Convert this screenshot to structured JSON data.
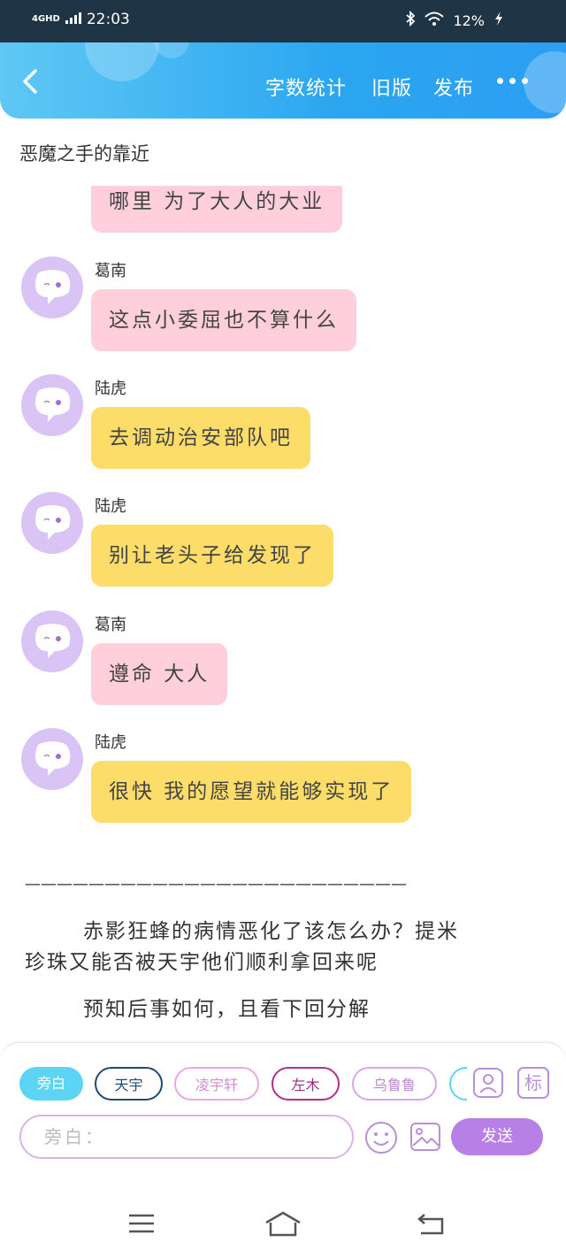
{
  "status_bar": {
    "network": "4GHD",
    "time": "22:03",
    "battery": "12%"
  },
  "toolbar": {
    "word_count": "字数统计",
    "old_version": "旧版",
    "publish": "发布"
  },
  "chapter_title": "恶魔之手的靠近",
  "messages": [
    {
      "sender": "",
      "text": "哪里 为了大人的大业",
      "color": "pink"
    },
    {
      "sender": "葛南",
      "text": "这点小委屈也不算什么",
      "color": "pink"
    },
    {
      "sender": "陆虎",
      "text": "去调动治安部队吧",
      "color": "yellow"
    },
    {
      "sender": "陆虎",
      "text": "别让老头子给发现了",
      "color": "yellow"
    },
    {
      "sender": "葛南",
      "text": "遵命 大人",
      "color": "pink"
    },
    {
      "sender": "陆虎",
      "text": "很快 我的愿望就能够实现了",
      "color": "yellow"
    }
  ],
  "divider": "————————————————————————",
  "story": {
    "p1_line1": "赤影狂蜂的病情恶化了该怎么办？提米",
    "p1_line2": "珍珠又能否被天宇他们顺利拿回来呢",
    "p2": "预知后事如何，且看下回分解"
  },
  "roles": [
    "旁白",
    "天宇",
    "凌宇轩",
    "左木",
    "乌鲁鲁"
  ],
  "tools": {
    "tag_label": "标"
  },
  "input": {
    "placeholder": "旁白：",
    "send_label": "发送"
  },
  "colors": {
    "accent": "#2aa6f0",
    "pink_bubble": "#ffd0db",
    "yellow_bubble": "#fddd6a",
    "send": "#b87fe6"
  }
}
